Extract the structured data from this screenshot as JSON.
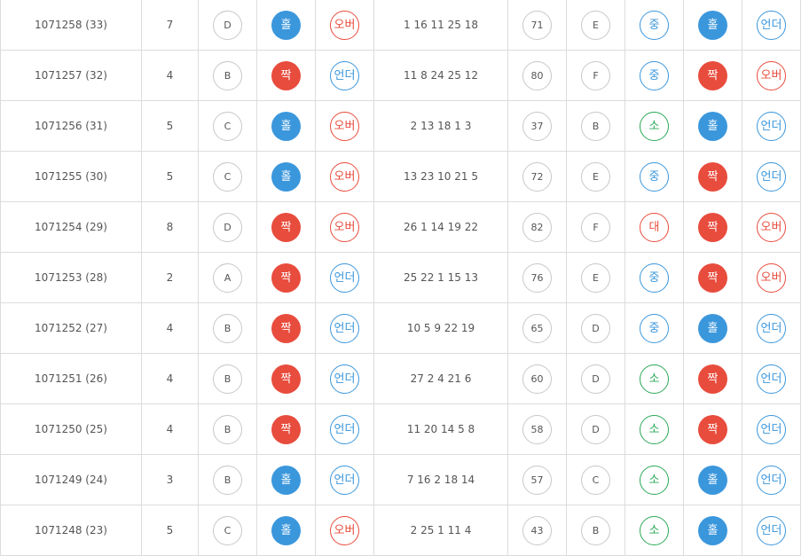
{
  "colors": {
    "blue": "#3b97dc",
    "red": "#e84c3d",
    "green": "#2aa857",
    "grey": "#c8c8c8"
  },
  "rows": [
    {
      "round": "1071258 (33)",
      "num": "7",
      "grade": "D",
      "oddeven": "홀",
      "oddeven_color": "blue",
      "overunder": "오버",
      "overunder_color": "red",
      "numbers": "1 16 11 25 18",
      "sum": "71",
      "sum_grade": "E",
      "size": "중",
      "size_color": "blue",
      "sum_oddeven": "홀",
      "sum_oddeven_color": "blue",
      "sum_overunder": "언더",
      "sum_overunder_color": "blue"
    },
    {
      "round": "1071257 (32)",
      "num": "4",
      "grade": "B",
      "oddeven": "짝",
      "oddeven_color": "red",
      "overunder": "언더",
      "overunder_color": "blue",
      "numbers": "11 8 24 25 12",
      "sum": "80",
      "sum_grade": "F",
      "size": "중",
      "size_color": "blue",
      "sum_oddeven": "짝",
      "sum_oddeven_color": "red",
      "sum_overunder": "오버",
      "sum_overunder_color": "red"
    },
    {
      "round": "1071256 (31)",
      "num": "5",
      "grade": "C",
      "oddeven": "홀",
      "oddeven_color": "blue",
      "overunder": "오버",
      "overunder_color": "red",
      "numbers": "2 13 18 1 3",
      "sum": "37",
      "sum_grade": "B",
      "size": "소",
      "size_color": "green",
      "sum_oddeven": "홀",
      "sum_oddeven_color": "blue",
      "sum_overunder": "언더",
      "sum_overunder_color": "blue"
    },
    {
      "round": "1071255 (30)",
      "num": "5",
      "grade": "C",
      "oddeven": "홀",
      "oddeven_color": "blue",
      "overunder": "오버",
      "overunder_color": "red",
      "numbers": "13 23 10 21 5",
      "sum": "72",
      "sum_grade": "E",
      "size": "중",
      "size_color": "blue",
      "sum_oddeven": "짝",
      "sum_oddeven_color": "red",
      "sum_overunder": "언더",
      "sum_overunder_color": "blue"
    },
    {
      "round": "1071254 (29)",
      "num": "8",
      "grade": "D",
      "oddeven": "짝",
      "oddeven_color": "red",
      "overunder": "오버",
      "overunder_color": "red",
      "numbers": "26 1 14 19 22",
      "sum": "82",
      "sum_grade": "F",
      "size": "대",
      "size_color": "red",
      "sum_oddeven": "짝",
      "sum_oddeven_color": "red",
      "sum_overunder": "오버",
      "sum_overunder_color": "red"
    },
    {
      "round": "1071253 (28)",
      "num": "2",
      "grade": "A",
      "oddeven": "짝",
      "oddeven_color": "red",
      "overunder": "언더",
      "overunder_color": "blue",
      "numbers": "25 22 1 15 13",
      "sum": "76",
      "sum_grade": "E",
      "size": "중",
      "size_color": "blue",
      "sum_oddeven": "짝",
      "sum_oddeven_color": "red",
      "sum_overunder": "오버",
      "sum_overunder_color": "red"
    },
    {
      "round": "1071252 (27)",
      "num": "4",
      "grade": "B",
      "oddeven": "짝",
      "oddeven_color": "red",
      "overunder": "언더",
      "overunder_color": "blue",
      "numbers": "10 5 9 22 19",
      "sum": "65",
      "sum_grade": "D",
      "size": "중",
      "size_color": "blue",
      "sum_oddeven": "홀",
      "sum_oddeven_color": "blue",
      "sum_overunder": "언더",
      "sum_overunder_color": "blue"
    },
    {
      "round": "1071251 (26)",
      "num": "4",
      "grade": "B",
      "oddeven": "짝",
      "oddeven_color": "red",
      "overunder": "언더",
      "overunder_color": "blue",
      "numbers": "27 2 4 21 6",
      "sum": "60",
      "sum_grade": "D",
      "size": "소",
      "size_color": "green",
      "sum_oddeven": "짝",
      "sum_oddeven_color": "red",
      "sum_overunder": "언더",
      "sum_overunder_color": "blue"
    },
    {
      "round": "1071250 (25)",
      "num": "4",
      "grade": "B",
      "oddeven": "짝",
      "oddeven_color": "red",
      "overunder": "언더",
      "overunder_color": "blue",
      "numbers": "11 20 14 5 8",
      "sum": "58",
      "sum_grade": "D",
      "size": "소",
      "size_color": "green",
      "sum_oddeven": "짝",
      "sum_oddeven_color": "red",
      "sum_overunder": "언더",
      "sum_overunder_color": "blue"
    },
    {
      "round": "1071249 (24)",
      "num": "3",
      "grade": "B",
      "oddeven": "홀",
      "oddeven_color": "blue",
      "overunder": "언더",
      "overunder_color": "blue",
      "numbers": "7 16 2 18 14",
      "sum": "57",
      "sum_grade": "C",
      "size": "소",
      "size_color": "green",
      "sum_oddeven": "홀",
      "sum_oddeven_color": "blue",
      "sum_overunder": "언더",
      "sum_overunder_color": "blue"
    },
    {
      "round": "1071248 (23)",
      "num": "5",
      "grade": "C",
      "oddeven": "홀",
      "oddeven_color": "blue",
      "overunder": "오버",
      "overunder_color": "red",
      "numbers": "2 25 1 11 4",
      "sum": "43",
      "sum_grade": "B",
      "size": "소",
      "size_color": "green",
      "sum_oddeven": "홀",
      "sum_oddeven_color": "blue",
      "sum_overunder": "언더",
      "sum_overunder_color": "blue"
    }
  ]
}
